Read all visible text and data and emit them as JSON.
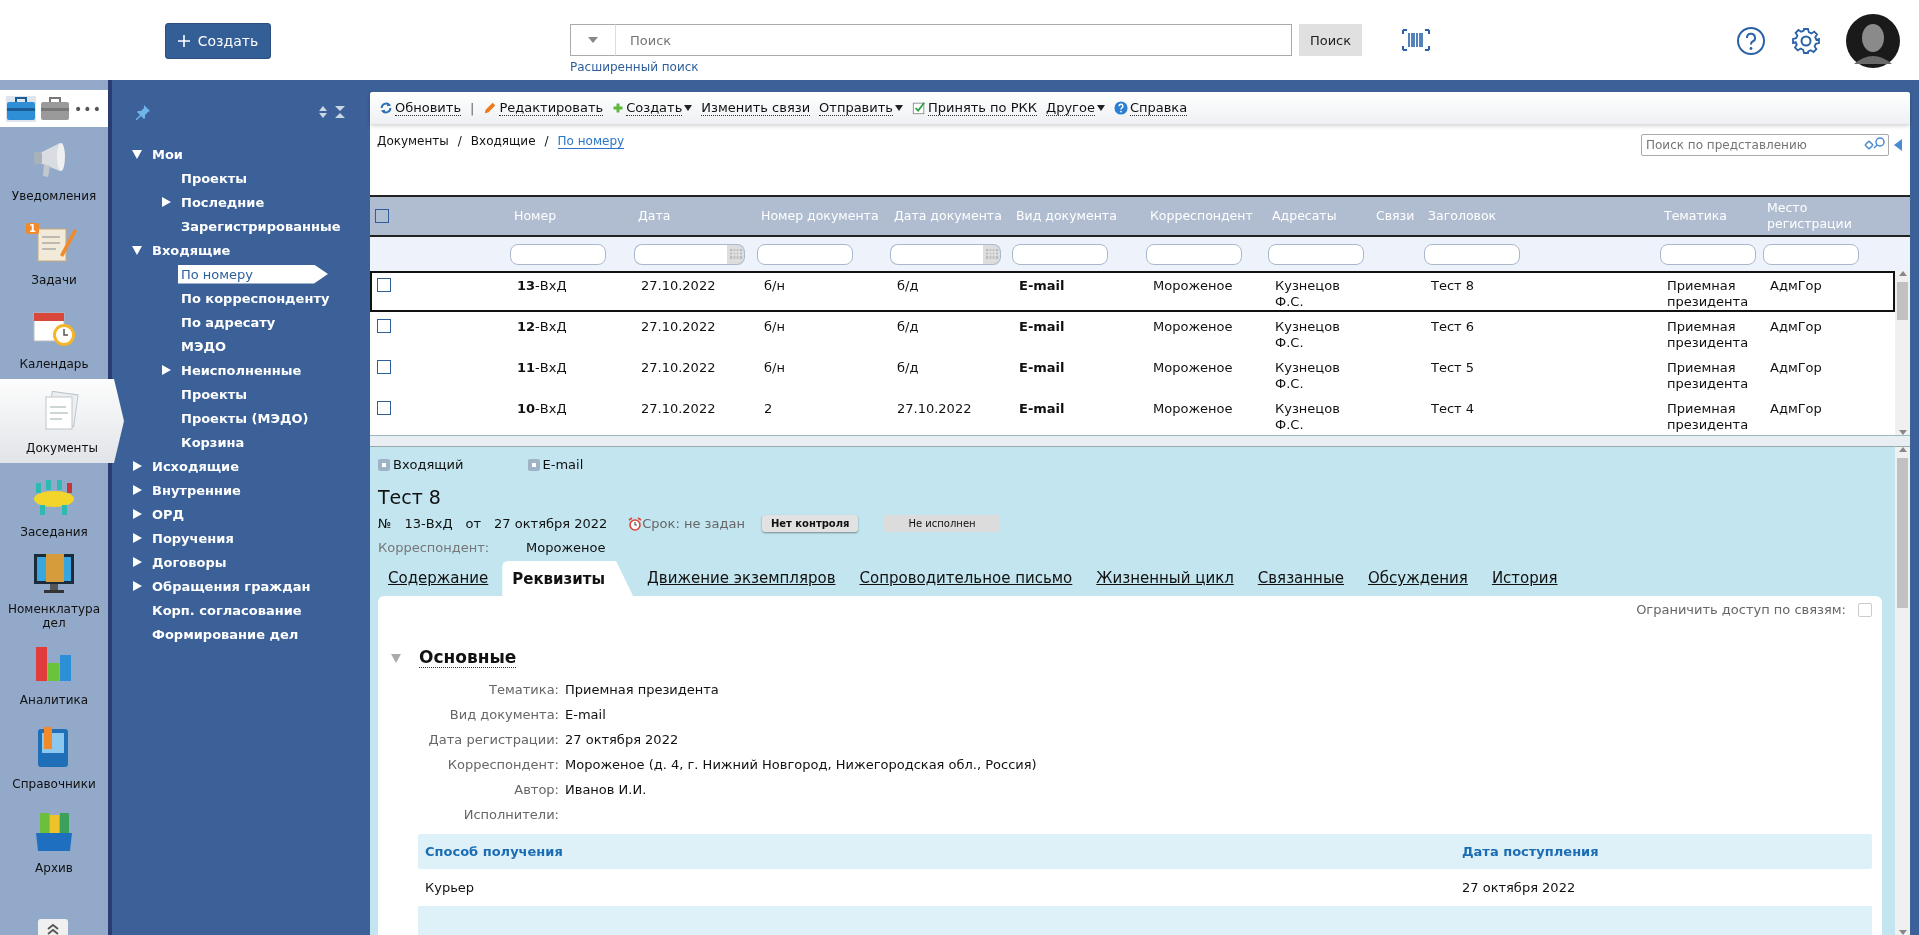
{
  "top_bar": {
    "create_button": "Создать",
    "search": {
      "placeholder": "Поиск",
      "button": "Поиск",
      "advanced_link": "Расширенный поиск"
    }
  },
  "app_rail": {
    "more": "•••",
    "items": [
      {
        "label": "Уведомления",
        "selected": false
      },
      {
        "label": "Задачи",
        "selected": false,
        "badge": "1"
      },
      {
        "label": "Календарь",
        "selected": false
      },
      {
        "label": "Документы",
        "selected": true
      },
      {
        "label": "Заседания",
        "selected": false
      },
      {
        "label": "Номенклатура дел",
        "selected": false
      },
      {
        "label": "Аналитика",
        "selected": false
      },
      {
        "label": "Справочники",
        "selected": false
      },
      {
        "label": "Архив",
        "selected": false
      }
    ]
  },
  "nav_tree": {
    "items": [
      {
        "label": "Мои",
        "expanded": true,
        "selected": false,
        "children": [
          {
            "label": "Проекты",
            "selected": false
          },
          {
            "label": "Последние",
            "expanded": false,
            "selected": false
          },
          {
            "label": "Зарегистрированные",
            "selected": false
          }
        ]
      },
      {
        "label": "Входящие",
        "expanded": true,
        "selected": false,
        "children": [
          {
            "label": "По номеру",
            "selected": true
          },
          {
            "label": "По корреспонденту",
            "selected": false
          },
          {
            "label": "По адресату",
            "selected": false
          },
          {
            "label": "МЭДО",
            "selected": false
          },
          {
            "label": "Неисполненные",
            "expanded": false,
            "selected": false
          },
          {
            "label": "Проекты",
            "selected": false
          },
          {
            "label": "Проекты (МЭДО)",
            "selected": false
          },
          {
            "label": "Корзина",
            "selected": false
          }
        ]
      },
      {
        "label": "Исходящие",
        "expanded": false,
        "selected": false
      },
      {
        "label": "Внутренние",
        "expanded": false,
        "selected": false
      },
      {
        "label": "ОРД",
        "expanded": false,
        "selected": false
      },
      {
        "label": "Поручения",
        "expanded": false,
        "selected": false
      },
      {
        "label": "Договоры",
        "expanded": false,
        "selected": false
      },
      {
        "label": "Обращения граждан",
        "expanded": false,
        "selected": false
      },
      {
        "label": "Корп. согласование",
        "selected": false
      },
      {
        "label": "Формирование дел",
        "selected": false
      }
    ]
  },
  "toolbar": [
    {
      "kind": "button",
      "label": "Обновить",
      "menu": false
    },
    {
      "kind": "separator",
      "label": "|"
    },
    {
      "kind": "button",
      "label": "Редактировать",
      "menu": false
    },
    {
      "kind": "button",
      "label": "Создать",
      "menu": true
    },
    {
      "kind": "button",
      "label": "Изменить связи",
      "menu": false
    },
    {
      "kind": "button",
      "label": "Отправить",
      "menu": true
    },
    {
      "kind": "button",
      "label": "Принять по РКК",
      "menu": false
    },
    {
      "kind": "button",
      "label": "Другое",
      "menu": true
    },
    {
      "kind": "button",
      "label": "Справка",
      "menu": false
    }
  ],
  "breadcrumb": {
    "separator": "/",
    "items": [
      {
        "label": "Документы",
        "current": false
      },
      {
        "label": "Входящие",
        "current": false
      },
      {
        "label": "По номеру",
        "current": true
      }
    ]
  },
  "view_search": {
    "placeholder": "Поиск по представлению"
  },
  "table": {
    "select_all": false,
    "columns": [
      {
        "label": "Номер",
        "kind": "text"
      },
      {
        "label": "Дата",
        "kind": "date"
      },
      {
        "label": "Номер документа",
        "kind": "text"
      },
      {
        "label": "Дата документа",
        "kind": "date"
      },
      {
        "label": "Вид документа",
        "kind": "text"
      },
      {
        "label": "Корреспондент",
        "kind": "text"
      },
      {
        "label": "Адресаты",
        "kind": "text"
      },
      {
        "label": "Связи",
        "kind": "none"
      },
      {
        "label": "Заголовок",
        "kind": "text"
      },
      {
        "label": "Тематика",
        "kind": "text"
      },
      {
        "label": "Место регистрации",
        "kind": "text"
      }
    ],
    "rows": [
      {
        "checked": false,
        "selected": true,
        "cells": [
          "**13**-ВхД",
          "27.10.2022",
          "б/н",
          "б/д",
          "E-mail",
          "Мороженое",
          "Кузнецов Ф.С.",
          null,
          "Тест 8",
          "Приемная президента",
          "АдмГор"
        ]
      },
      {
        "checked": false,
        "selected": false,
        "cells": [
          "**12**-ВхД",
          "27.10.2022",
          "б/н",
          "б/д",
          "E-mail",
          "Мороженое",
          "Кузнецов Ф.С.",
          null,
          "Тест 6",
          "Приемная президента",
          "АдмГор"
        ]
      },
      {
        "checked": false,
        "selected": false,
        "cells": [
          "**11**-ВхД",
          "27.10.2022",
          "б/н",
          "б/д",
          "E-mail",
          "Мороженое",
          "Кузнецов Ф.С.",
          null,
          "Тест 5",
          "Приемная президента",
          "АдмГор"
        ]
      },
      {
        "checked": false,
        "selected": false,
        "cells": [
          "**10**-ВхД",
          "27.10.2022",
          "2",
          "27.10.2022",
          "E-mail",
          "Мороженое",
          "Кузнецов Ф.С.",
          null,
          "Тест 4",
          "Приемная президента",
          "АдмГор"
        ]
      }
    ]
  },
  "detail": {
    "tags": [
      "Входящий",
      "E-mail"
    ],
    "title": "Тест 8",
    "meta": {
      "number_label": "№",
      "number": "13-ВхД",
      "from_label": "от",
      "date": "27 октября 2022",
      "deadline": "Срок: не задан",
      "control": "Нет контроля",
      "status": "Не исполнен"
    },
    "correspondent": {
      "label": "Корреспондент:",
      "value": "Мороженое"
    },
    "tabs": [
      {
        "label": "Содержание",
        "selected": false
      },
      {
        "label": "Реквизиты",
        "selected": true
      },
      {
        "label": "Движение экземпляров",
        "selected": false
      },
      {
        "label": "Сопроводительное письмо",
        "selected": false
      },
      {
        "label": "Жизненный цикл",
        "selected": false
      },
      {
        "label": "Связанные",
        "selected": false
      },
      {
        "label": "Обсуждения",
        "selected": false
      },
      {
        "label": "История",
        "selected": false
      }
    ],
    "restrict_access": {
      "label": "Ограничить доступ по связям:",
      "checked": false
    },
    "section": {
      "title": "Основные",
      "expanded": true,
      "fields": [
        {
          "label": "Тематика:",
          "value": "Приемная президента"
        },
        {
          "label": "Вид документа:",
          "value": "E-mail"
        },
        {
          "label": "Дата регистрации:",
          "value": "27 октября 2022"
        },
        {
          "label": "Корреспондент:",
          "value": "Мороженое (д. 4, г. Нижний Новгород, Нижегородская обл., Россия)"
        },
        {
          "label": "Автор:",
          "value": "Иванов И.И."
        },
        {
          "label": "Исполнители:"
        }
      ]
    },
    "receipt_table": {
      "columns": [
        "Способ получения",
        "Дата поступления"
      ],
      "rows": [
        [
          "Курьер",
          "27 октября 2022"
        ]
      ]
    }
  }
}
